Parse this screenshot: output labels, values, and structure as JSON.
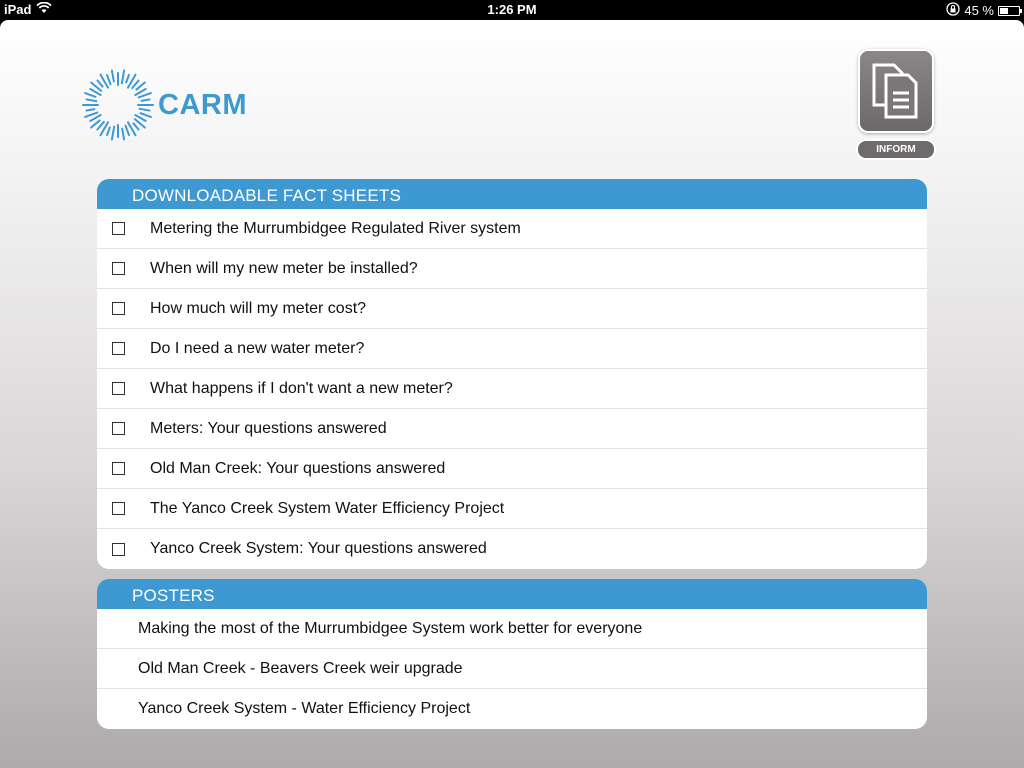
{
  "status_bar": {
    "device": "iPad",
    "time": "1:26 PM",
    "battery_percent": "45 %",
    "battery_level": 0.45
  },
  "app": {
    "logo_text": "CARM",
    "brand_color": "#3e99d2",
    "inform_label": "INFORM"
  },
  "fact_sheets": {
    "title": "DOWNLOADABLE FACT SHEETS",
    "items": [
      {
        "label": "Metering the Murrumbidgee Regulated River system",
        "checked": false
      },
      {
        "label": "When will my new meter be installed?",
        "checked": false
      },
      {
        "label": "How much will my meter cost?",
        "checked": false
      },
      {
        "label": "Do I need a new water meter?",
        "checked": false
      },
      {
        "label": "What happens if I don't want a new meter?",
        "checked": false
      },
      {
        "label": "Meters: Your questions answered",
        "checked": false
      },
      {
        "label": "Old Man Creek: Your questions answered",
        "checked": false
      },
      {
        "label": "The Yanco Creek System Water Efficiency Project",
        "checked": false
      },
      {
        "label": "Yanco Creek System: Your questions answered",
        "checked": false
      }
    ]
  },
  "posters": {
    "title": "POSTERS",
    "items": [
      {
        "label": "Making the most of the Murrumbidgee System work better for everyone"
      },
      {
        "label": "Old Man Creek - Beavers Creek weir upgrade"
      },
      {
        "label": "Yanco Creek System - Water Efficiency Project"
      }
    ]
  }
}
